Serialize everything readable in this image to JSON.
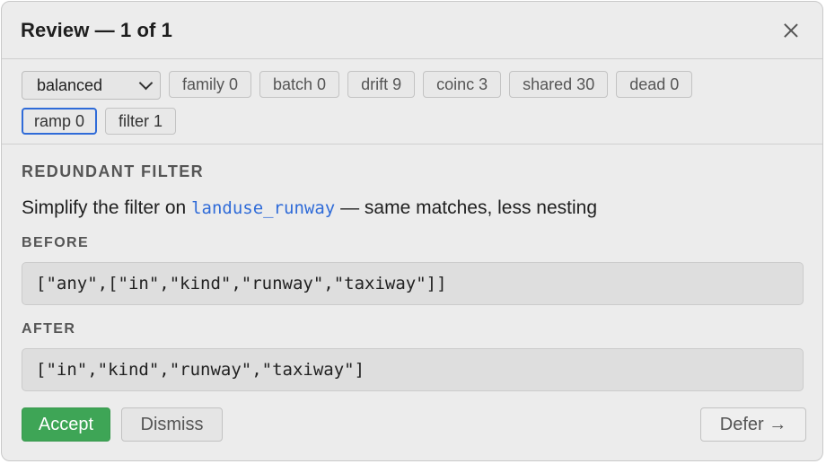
{
  "header": {
    "title": "Review — 1 of 1"
  },
  "filter_bar": {
    "mode_select": {
      "value": "balanced"
    },
    "chips_row1": [
      "family 0",
      "batch 0",
      "drift 9",
      "coinc 3",
      "shared 30",
      "dead 0"
    ],
    "chips_row2": [
      "ramp 0",
      "filter 1"
    ]
  },
  "suggestion": {
    "category": "REDUNDANT FILTER",
    "description_prefix": "Simplify the filter on ",
    "layer_name": "landuse_runway",
    "description_suffix": " — same matches, less nesting",
    "before_label": "BEFORE",
    "before_code": "[\"any\",[\"in\",\"kind\",\"runway\",\"taxiway\"]]",
    "after_label": "AFTER",
    "after_code": "[\"in\",\"kind\",\"runway\",\"taxiway\"]"
  },
  "actions": {
    "accept": "Accept",
    "dismiss": "Dismiss",
    "defer": "Defer →"
  },
  "colors": {
    "accent": "#2f6bd8",
    "accept_green": "#3ea556"
  }
}
